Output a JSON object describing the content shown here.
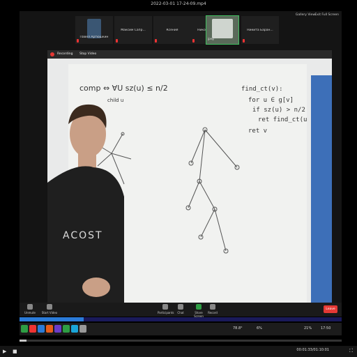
{
  "player": {
    "title": "2022-03-01 17-24-09.mp4",
    "time": "00:01:33/01:10:01",
    "seek_fraction": 0.022
  },
  "zoom": {
    "gallery_view": "Gallery View",
    "exit_full_screen": "Exit Full Screen",
    "participants": [
      {
        "name": "Павел Артюшкин",
        "video": true
      },
      {
        "name": "Максим Сапр...",
        "video": false
      },
      {
        "name": "Ксения",
        "video": false
      },
      {
        "name": "Николай Фед...",
        "video": false
      },
      {
        "name": "",
        "video": true,
        "active": true,
        "badge": "jpeg"
      },
      {
        "name": "Никита Баран...",
        "video": false
      }
    ],
    "recording_label": "Recording",
    "stop_video": "Stop Video",
    "speaker_label": "jpeg",
    "toolbar": {
      "unmute": "Unmute",
      "start_video": "Start Video",
      "participants": "Participants",
      "participants_count": "3",
      "chat": "Chat",
      "share_screen": "Share Screen",
      "record": "Record",
      "end": "Leave"
    },
    "progress_fraction": 0.2
  },
  "whiteboard": {
    "left_formula": "comp ⇔ ∀U   sz(u) ≤ n/2",
    "left_sub": "child u",
    "code": [
      "find_ct(v):",
      "for u ∈ g[v]",
      "if sz(u) > n/2",
      "ret find_ct(u)",
      "ret v"
    ]
  },
  "taskbar": {
    "cpu": "78.8°",
    "wifi": "6%",
    "battery": "21%",
    "clock": "17:50"
  },
  "colors": {
    "accent": "#2b7bd8",
    "end": "#e53935",
    "active": "#40c060"
  }
}
